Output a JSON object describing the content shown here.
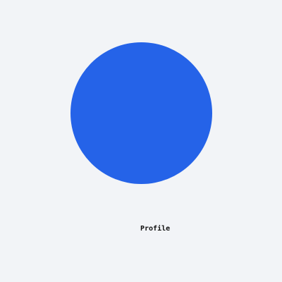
{
  "profile": {
    "label": "Profile",
    "avatar_color": "#2563e8",
    "background_color": "#f2f4f7"
  }
}
